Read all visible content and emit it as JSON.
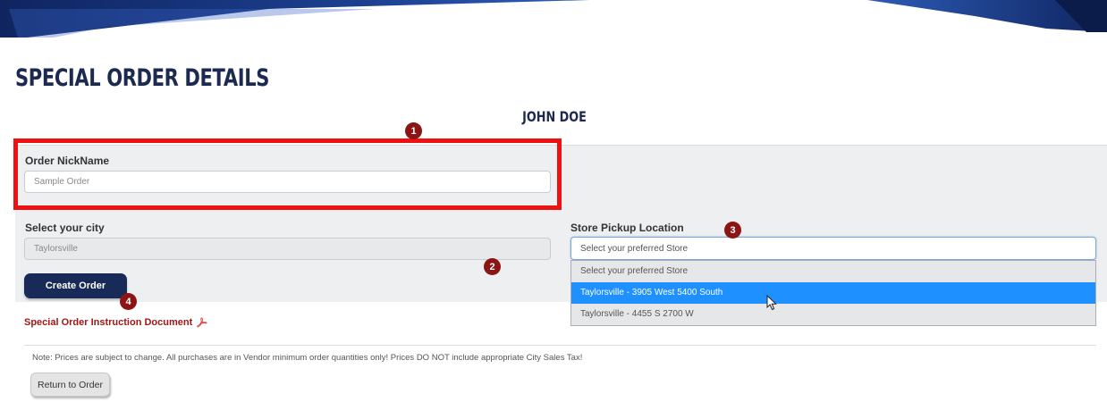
{
  "page": {
    "title": "SPECIAL ORDER DETAILS",
    "customer_name": "JOHN DOE"
  },
  "form": {
    "nickname_label": "Order NickName",
    "nickname_value": "Sample Order",
    "city_label": "Select your city",
    "city_value": "Taylorsville",
    "store_label": "Store Pickup Location",
    "store_value": "Select your preferred Store",
    "store_options": [
      "Select your preferred Store",
      "Taylorsville - 3905 West 5400 South",
      "Taylorsville - 4455 S 2700 W"
    ],
    "store_selected_index": 1,
    "create_button": "Create Order"
  },
  "badges": [
    "1",
    "2",
    "3",
    "4"
  ],
  "instructions": {
    "link_text": "Special Order Instruction Document",
    "icon": "pdf-icon"
  },
  "footer": {
    "note": "Note: Prices are subject to change. All purchases are in Vendor minimum order quantities only! Prices DO NOT include appropriate City Sales Tax!",
    "return_button": "Return to Order"
  },
  "colors": {
    "navy": "#182a57",
    "highlight": "#ee1111",
    "badge": "#8b1414",
    "link": "#a01818",
    "selected_option": "#1e90ff"
  }
}
